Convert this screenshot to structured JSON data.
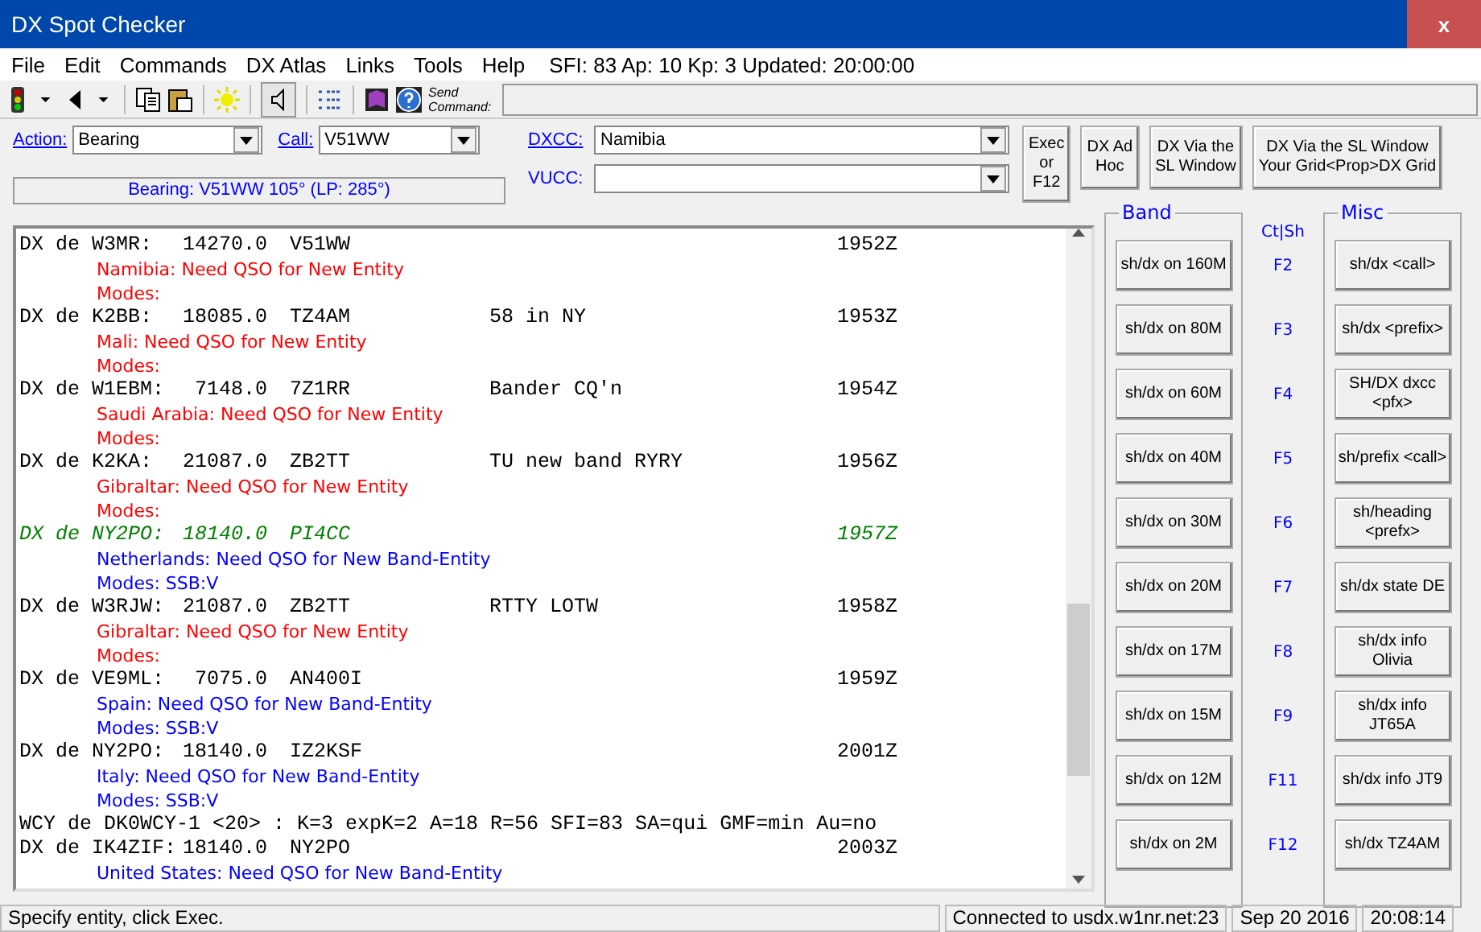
{
  "window": {
    "title": "DX Spot Checker",
    "close": "x"
  },
  "menu": [
    "File",
    "Edit",
    "Commands",
    "DX Atlas",
    "Links",
    "Tools",
    "Help"
  ],
  "solar_info": "SFI: 83 Ap: 10 Kp: 3 Updated: 20:00:00",
  "toolbar": {
    "speaker_pressed": true,
    "send_command_label": "Send Command:"
  },
  "form": {
    "action": {
      "label": "Action:",
      "value": "Bearing"
    },
    "call": {
      "label": "Call:",
      "value": "V51WW"
    },
    "dxcc": {
      "label": "DXCC:",
      "value": "Namibia"
    },
    "vucc": {
      "label": "VUCC:"
    },
    "bearing": "Bearing: V51WW 105° (LP: 285°)"
  },
  "top_buttons": [
    {
      "lines": [
        "Exec",
        "or",
        "F12"
      ]
    },
    {
      "lines": [
        "DX Ad",
        "Hoc"
      ]
    },
    {
      "lines": [
        "DX Via the",
        "SL Window"
      ]
    },
    {
      "lines": [
        "DX Via the SL Window",
        "Your Grid<Prop>DX Grid"
      ]
    }
  ],
  "log": [
    {
      "kind": "spot",
      "spotter": "DX de W3MR:",
      "freq": "14270.0",
      "dx": "V51WW",
      "time": "1952Z",
      "highlighted": false
    },
    {
      "kind": "info",
      "text": "Namibia: Need QSO for New Entity",
      "color": "#ff0000"
    },
    {
      "kind": "info",
      "text": "Modes:",
      "color": "#ff0000"
    },
    {
      "kind": "spot",
      "spotter": "DX de K2BB:",
      "freq": "18085.0",
      "dx": "TZ4AM",
      "comment": "58 in NY",
      "time": "1953Z",
      "highlighted": false
    },
    {
      "kind": "info",
      "text": "Mali: Need QSO for New Entity",
      "color": "#ff0000"
    },
    {
      "kind": "info",
      "text": "Modes:",
      "color": "#ff0000"
    },
    {
      "kind": "spot",
      "spotter": "DX de W1EBM:",
      "freq": "7148.0",
      "dx": "7Z1RR",
      "comment": "Bander CQ'n",
      "time": "1954Z",
      "highlighted": false
    },
    {
      "kind": "info",
      "text": "Saudi Arabia: Need QSO for New Entity",
      "color": "#ff0000"
    },
    {
      "kind": "info",
      "text": "Modes:",
      "color": "#ff0000"
    },
    {
      "kind": "spot",
      "spotter": "DX de K2KA:",
      "freq": "21087.0",
      "dx": "ZB2TT",
      "comment": "TU new band RYRY",
      "time": "1956Z",
      "highlighted": false
    },
    {
      "kind": "info",
      "text": "Gibraltar: Need QSO for New Entity",
      "color": "#ff0000"
    },
    {
      "kind": "info",
      "text": "Modes:",
      "color": "#ff0000"
    },
    {
      "kind": "spot",
      "spotter": "DX de NY2PO:",
      "freq": "18140.0",
      "dx": "PI4CC",
      "time": "1957Z",
      "highlighted": true
    },
    {
      "kind": "info",
      "text": "Netherlands: Need QSO for New Band-Entity",
      "color": "#0000ff"
    },
    {
      "kind": "info",
      "text": "Modes: SSB:V",
      "color": "#0000ff"
    },
    {
      "kind": "spot",
      "spotter": "DX de W3RJW:",
      "freq": "21087.0",
      "dx": "ZB2TT",
      "comment": "RTTY LOTW",
      "time": "1958Z",
      "highlighted": false
    },
    {
      "kind": "info",
      "text": "Gibraltar: Need QSO for New Entity",
      "color": "#ff0000"
    },
    {
      "kind": "info",
      "text": "Modes:",
      "color": "#ff0000"
    },
    {
      "kind": "spot",
      "spotter": "DX de VE9ML:",
      "freq": "7075.0",
      "dx": "AN400I",
      "time": "1959Z",
      "highlighted": false
    },
    {
      "kind": "info",
      "text": "Spain: Need QSO for New Band-Entity",
      "color": "#0000ff"
    },
    {
      "kind": "info",
      "text": "Modes: SSB:V",
      "color": "#0000ff"
    },
    {
      "kind": "spot",
      "spotter": "DX de NY2PO:",
      "freq": "18140.0",
      "dx": "IZ2KSF",
      "time": "2001Z",
      "highlighted": false
    },
    {
      "kind": "info",
      "text": "Italy: Need QSO for New Band-Entity",
      "color": "#0000ff"
    },
    {
      "kind": "info",
      "text": "Modes: SSB:V",
      "color": "#0000ff"
    },
    {
      "kind": "wcy",
      "text": "WCY de DK0WCY-1 <20> : K=3 expK=2 A=18 R=56 SFI=83 SA=qui GMF=min Au=no"
    },
    {
      "kind": "spot",
      "spotter": "DX de IK4ZIF:",
      "freq": "18140.0",
      "dx": "NY2PO",
      "time": "2003Z",
      "highlighted": false
    },
    {
      "kind": "info",
      "text": "United States: Need QSO for New Band-Entity",
      "color": "#0000ff"
    }
  ],
  "band": {
    "title": "Band",
    "buttons": [
      "sh/dx on 160M",
      "sh/dx on 80M",
      "sh/dx on 60M",
      "sh/dx on 40M",
      "sh/dx on 30M",
      "sh/dx on 20M",
      "sh/dx on 17M",
      "sh/dx on 15M",
      "sh/dx on 12M",
      "sh/dx on 2M"
    ]
  },
  "keys": {
    "title": "Ct|Sh",
    "items": [
      "F2",
      "F3",
      "F4",
      "F5",
      "F6",
      "F7",
      "F8",
      "F9",
      "F11",
      "F12"
    ]
  },
  "misc": {
    "title": "Misc",
    "buttons": [
      [
        "sh/dx <call>"
      ],
      [
        "sh/dx <prefix>"
      ],
      [
        "SH/DX dxcc",
        "<pfx>"
      ],
      [
        "sh/prefix <call>"
      ],
      [
        "sh/heading",
        "<prefx>"
      ],
      [
        "sh/dx state DE"
      ],
      [
        "sh/dx info",
        "Olivia"
      ],
      [
        "sh/dx info",
        "JT65A"
      ],
      [
        "sh/dx info JT9"
      ],
      [
        "sh/dx TZ4AM"
      ]
    ]
  },
  "status_bar": {
    "message": "Specify entity, click Exec.",
    "connection": "Connected to usdx.w1nr.net:23",
    "date": "Sep 20 2016",
    "time": "20:08:14"
  }
}
